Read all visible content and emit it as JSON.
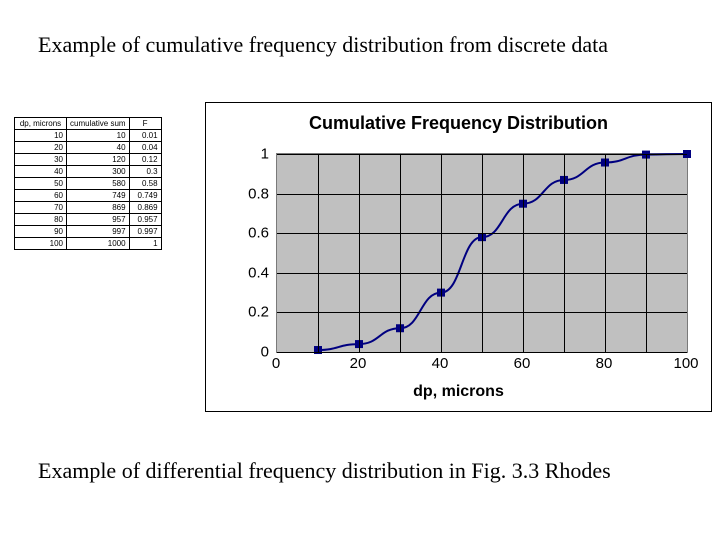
{
  "headings": {
    "top": "Example of cumulative frequency distribution from discrete data",
    "bottom": "Example of differential frequency distribution in Fig. 3.3 Rhodes"
  },
  "table": {
    "headers": [
      "dp, microns",
      "cumulative sum",
      "F"
    ],
    "rows": [
      [
        10,
        10,
        "0.01"
      ],
      [
        20,
        40,
        "0.04"
      ],
      [
        30,
        120,
        "0.12"
      ],
      [
        40,
        300,
        "0.3"
      ],
      [
        50,
        580,
        "0.58"
      ],
      [
        60,
        749,
        "0.749"
      ],
      [
        70,
        869,
        "0.869"
      ],
      [
        80,
        957,
        "0.957"
      ],
      [
        90,
        997,
        "0.997"
      ],
      [
        100,
        1000,
        "1"
      ]
    ]
  },
  "chart_data": {
    "type": "line",
    "title": "Cumulative Frequency Distribution",
    "xlabel": "dp, microns",
    "ylabel": "",
    "xlim": [
      0,
      100
    ],
    "ylim": [
      0,
      1
    ],
    "xticks": [
      0,
      20,
      40,
      60,
      80,
      100
    ],
    "yticks": [
      0,
      0.2,
      0.4,
      0.6,
      0.8,
      1
    ],
    "x": [
      10,
      20,
      30,
      40,
      50,
      60,
      70,
      80,
      90,
      100
    ],
    "y": [
      0.01,
      0.04,
      0.12,
      0.3,
      0.58,
      0.749,
      0.869,
      0.957,
      0.997,
      1.0
    ]
  }
}
